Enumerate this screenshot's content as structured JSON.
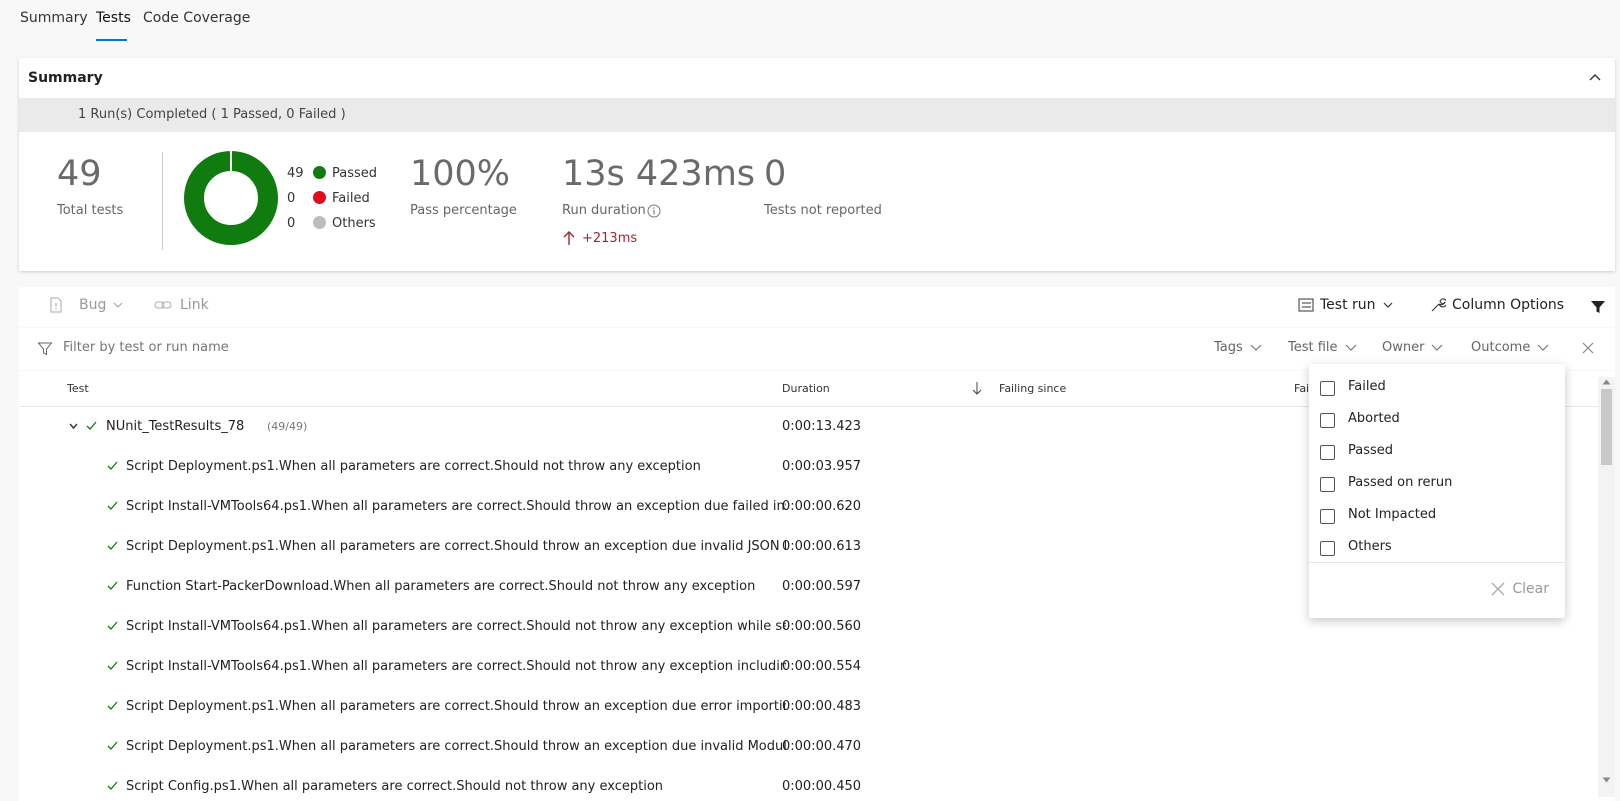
{
  "tabs": [
    {
      "label": "Summary"
    },
    {
      "label": "Tests"
    },
    {
      "label": "Code Coverage"
    }
  ],
  "summary": {
    "header": "Summary",
    "run_status": "1 Run(s) Completed ( 1 Passed, 0 Failed )",
    "total_tests": {
      "value": "49",
      "label": "Total tests"
    },
    "legend": [
      {
        "count": "49",
        "label": "Passed",
        "color": "#107c10"
      },
      {
        "count": "0",
        "label": "Failed",
        "color": "#e00b1c"
      },
      {
        "count": "0",
        "label": "Others",
        "color": "#bdbdbd"
      }
    ],
    "donut": {
      "passed": 49,
      "failed": 0,
      "others": 0
    },
    "pass_percentage": {
      "value": "100%",
      "label": "Pass percentage"
    },
    "run_duration": {
      "value": "13s 423ms",
      "label": "Run duration",
      "delta": "+213ms"
    },
    "not_reported": {
      "value": "0",
      "label": "Tests not reported"
    }
  },
  "toolbar": {
    "bug": "Bug",
    "link": "Link",
    "test_run": "Test run",
    "column_options": "Column Options"
  },
  "filter": {
    "placeholder": "Filter by test or run name",
    "tags": "Tags",
    "test_file": "Test file",
    "owner": "Owner",
    "outcome": "Outcome"
  },
  "grid": {
    "columns": {
      "test": "Test",
      "duration": "Duration",
      "failing_since": "Failing since",
      "failing_build": "Fai"
    },
    "group": {
      "name": "NUnit_TestResults_78",
      "count": "(49/49)",
      "duration": "0:00:13.423"
    },
    "rows": [
      {
        "name": "Script Deployment.ps1.When all parameters are correct.Should not throw any exception",
        "duration": "0:00:03.957"
      },
      {
        "name": "Script Install-VMTools64.ps1.When all parameters are correct.Should throw an exception due failed insta",
        "duration": "0:00:00.620"
      },
      {
        "name": "Script Deployment.ps1.When all parameters are correct.Should throw an exception due invalid JSON Pat",
        "duration": "0:00:00.613"
      },
      {
        "name": "Function Start-PackerDownload.When all parameters are correct.Should not throw any exception",
        "duration": "0:00:00.597"
      },
      {
        "name": "Script Install-VMTools64.ps1.When all parameters are correct.Should not throw any exception while servi",
        "duration": "0:00:00.560"
      },
      {
        "name": "Script Install-VMTools64.ps1.When all parameters are correct.Should not throw any exception including t",
        "duration": "0:00:00.554"
      },
      {
        "name": "Script Deployment.ps1.When all parameters are correct.Should throw an exception due error importing r",
        "duration": "0:00:00.483"
      },
      {
        "name": "Script Deployment.ps1.When all parameters are correct.Should throw an exception due invalid ModulePa",
        "duration": "0:00:00.470"
      },
      {
        "name": "Script Config.ps1.When all parameters are correct.Should not throw any exception",
        "duration": "0:00:00.450"
      }
    ]
  },
  "outcome_dropdown": {
    "options": [
      "Failed",
      "Aborted",
      "Passed",
      "Passed on rerun",
      "Not Impacted",
      "Others"
    ],
    "clear": "Clear"
  }
}
